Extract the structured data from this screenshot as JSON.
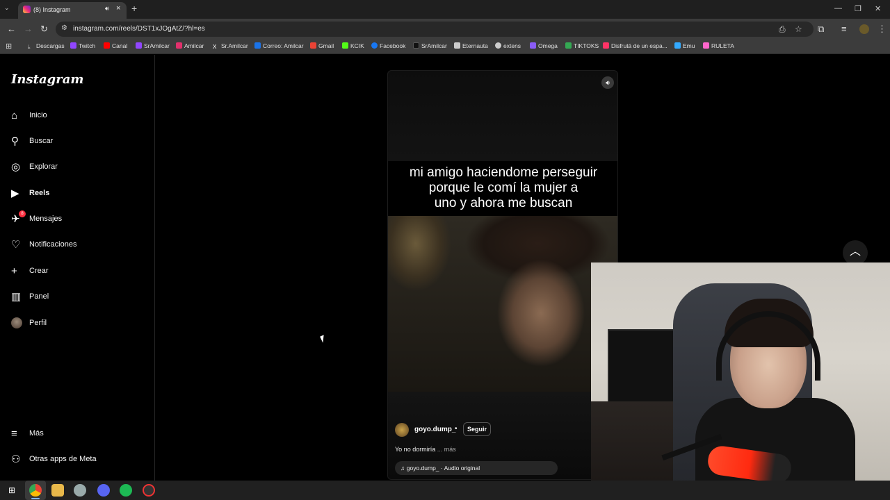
{
  "browser": {
    "tab_title": "(8) Instagram",
    "tab_mute_icon": "speaker-icon",
    "tab_close_icon": "close-icon",
    "new_tab_icon": "plus-icon",
    "url": "instagram.com/reels/DST1xJOgAtZ/?hl=es",
    "bookmarks": [
      {
        "label": "Descargas",
        "color": "#aaaaaa"
      },
      {
        "label": "Twitch",
        "color": "#9146ff"
      },
      {
        "label": "Canal",
        "color": "#ff0000"
      },
      {
        "label": "SrAmilcar",
        "color": "#9146ff"
      },
      {
        "label": "Amilcar",
        "color": "#e1306c"
      },
      {
        "label": "Sr.Amilcar",
        "color": "#ffffff"
      },
      {
        "label": "Correo: Amilcar",
        "color": "#1a73e8"
      },
      {
        "label": "Gmail",
        "color": "#ea4335"
      },
      {
        "label": "KCIK",
        "color": "#53fc18"
      },
      {
        "label": "Facebook",
        "color": "#1877f2"
      },
      {
        "label": "SrAmilcar",
        "color": "#ffffff"
      },
      {
        "label": "Eternauta",
        "color": "#cccccc"
      },
      {
        "label": "extens",
        "color": "#cccccc"
      },
      {
        "label": "Omega",
        "color": "#8a5cf6"
      },
      {
        "label": "TIKTOKS",
        "color": "#34a853"
      },
      {
        "label": "Disfrutá de un espa...",
        "color": "#ff3366"
      },
      {
        "label": "Emu",
        "color": "#33aaff"
      },
      {
        "label": "RULETA",
        "color": "#ff66cc"
      }
    ]
  },
  "sidebar": {
    "logo": "Instagram",
    "items": [
      {
        "label": "Inicio",
        "icon": "home-icon"
      },
      {
        "label": "Buscar",
        "icon": "search-icon"
      },
      {
        "label": "Explorar",
        "icon": "compass-icon"
      },
      {
        "label": "Reels",
        "icon": "reels-icon",
        "active": true
      },
      {
        "label": "Mensajes",
        "icon": "messenger-icon",
        "badge": "8"
      },
      {
        "label": "Notificaciones",
        "icon": "heart-icon"
      },
      {
        "label": "Crear",
        "icon": "plus-icon"
      },
      {
        "label": "Panel",
        "icon": "chart-icon"
      },
      {
        "label": "Perfil",
        "icon": "avatar-icon"
      }
    ],
    "bottom_items": [
      {
        "label": "Más",
        "icon": "menu-icon"
      },
      {
        "label": "Otras apps de Meta",
        "icon": "meta-apps-icon"
      }
    ]
  },
  "reel": {
    "caption_lines": [
      "mi amigo haciendome perseguir",
      "porque le comí la mujer a",
      "uno y ahora me buscan"
    ],
    "author": "goyo.dump_",
    "separator": "•",
    "follow_label": "Seguir",
    "description": "Yo no dormiría",
    "more_label": "... más",
    "audio": "goyo.dump_ · Audio original",
    "sound_icon": "speaker-icon"
  },
  "scroll_top_icon": "chevron-up-icon",
  "colors": {
    "badge": "#ff3040",
    "accent_blue": "#7fb6ff"
  }
}
